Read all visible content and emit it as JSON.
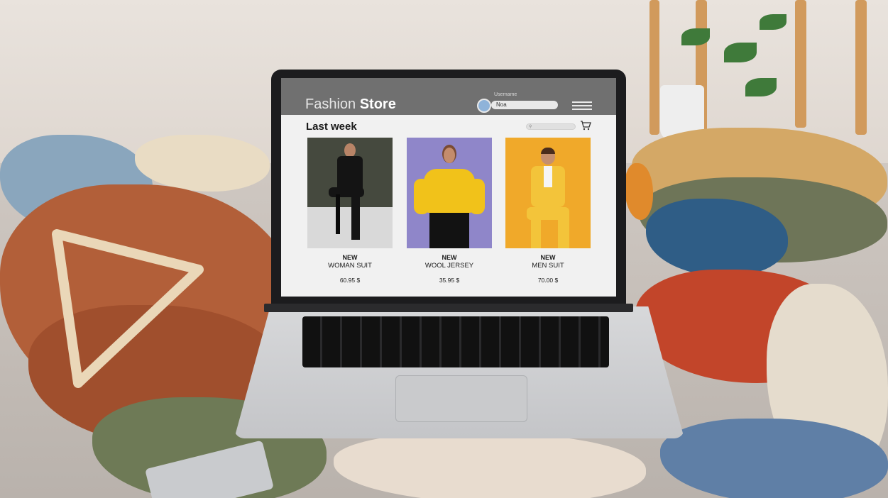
{
  "site": {
    "brand_light": "Fashion",
    "brand_bold": "Store",
    "username_caption": "Username",
    "username_value": "Noa",
    "section_title": "Last week"
  },
  "products": [
    {
      "tag": "NEW",
      "name": "WOMAN SUIT",
      "price": "60.95 $"
    },
    {
      "tag": "NEW",
      "name": "WOOL JERSEY",
      "price": "35.95 $"
    },
    {
      "tag": "NEW",
      "name": "MEN SUIT",
      "price": "70.00 $"
    }
  ],
  "icons": [
    "avatar",
    "menu-icon",
    "search-icon",
    "cart-icon"
  ],
  "colors": {
    "header": "#707070",
    "screen_bg": "#f1f1f1",
    "photo1_bg": "#45493e",
    "photo2_bg": "#8f86c9",
    "photo3_bg": "#f0a92a"
  }
}
